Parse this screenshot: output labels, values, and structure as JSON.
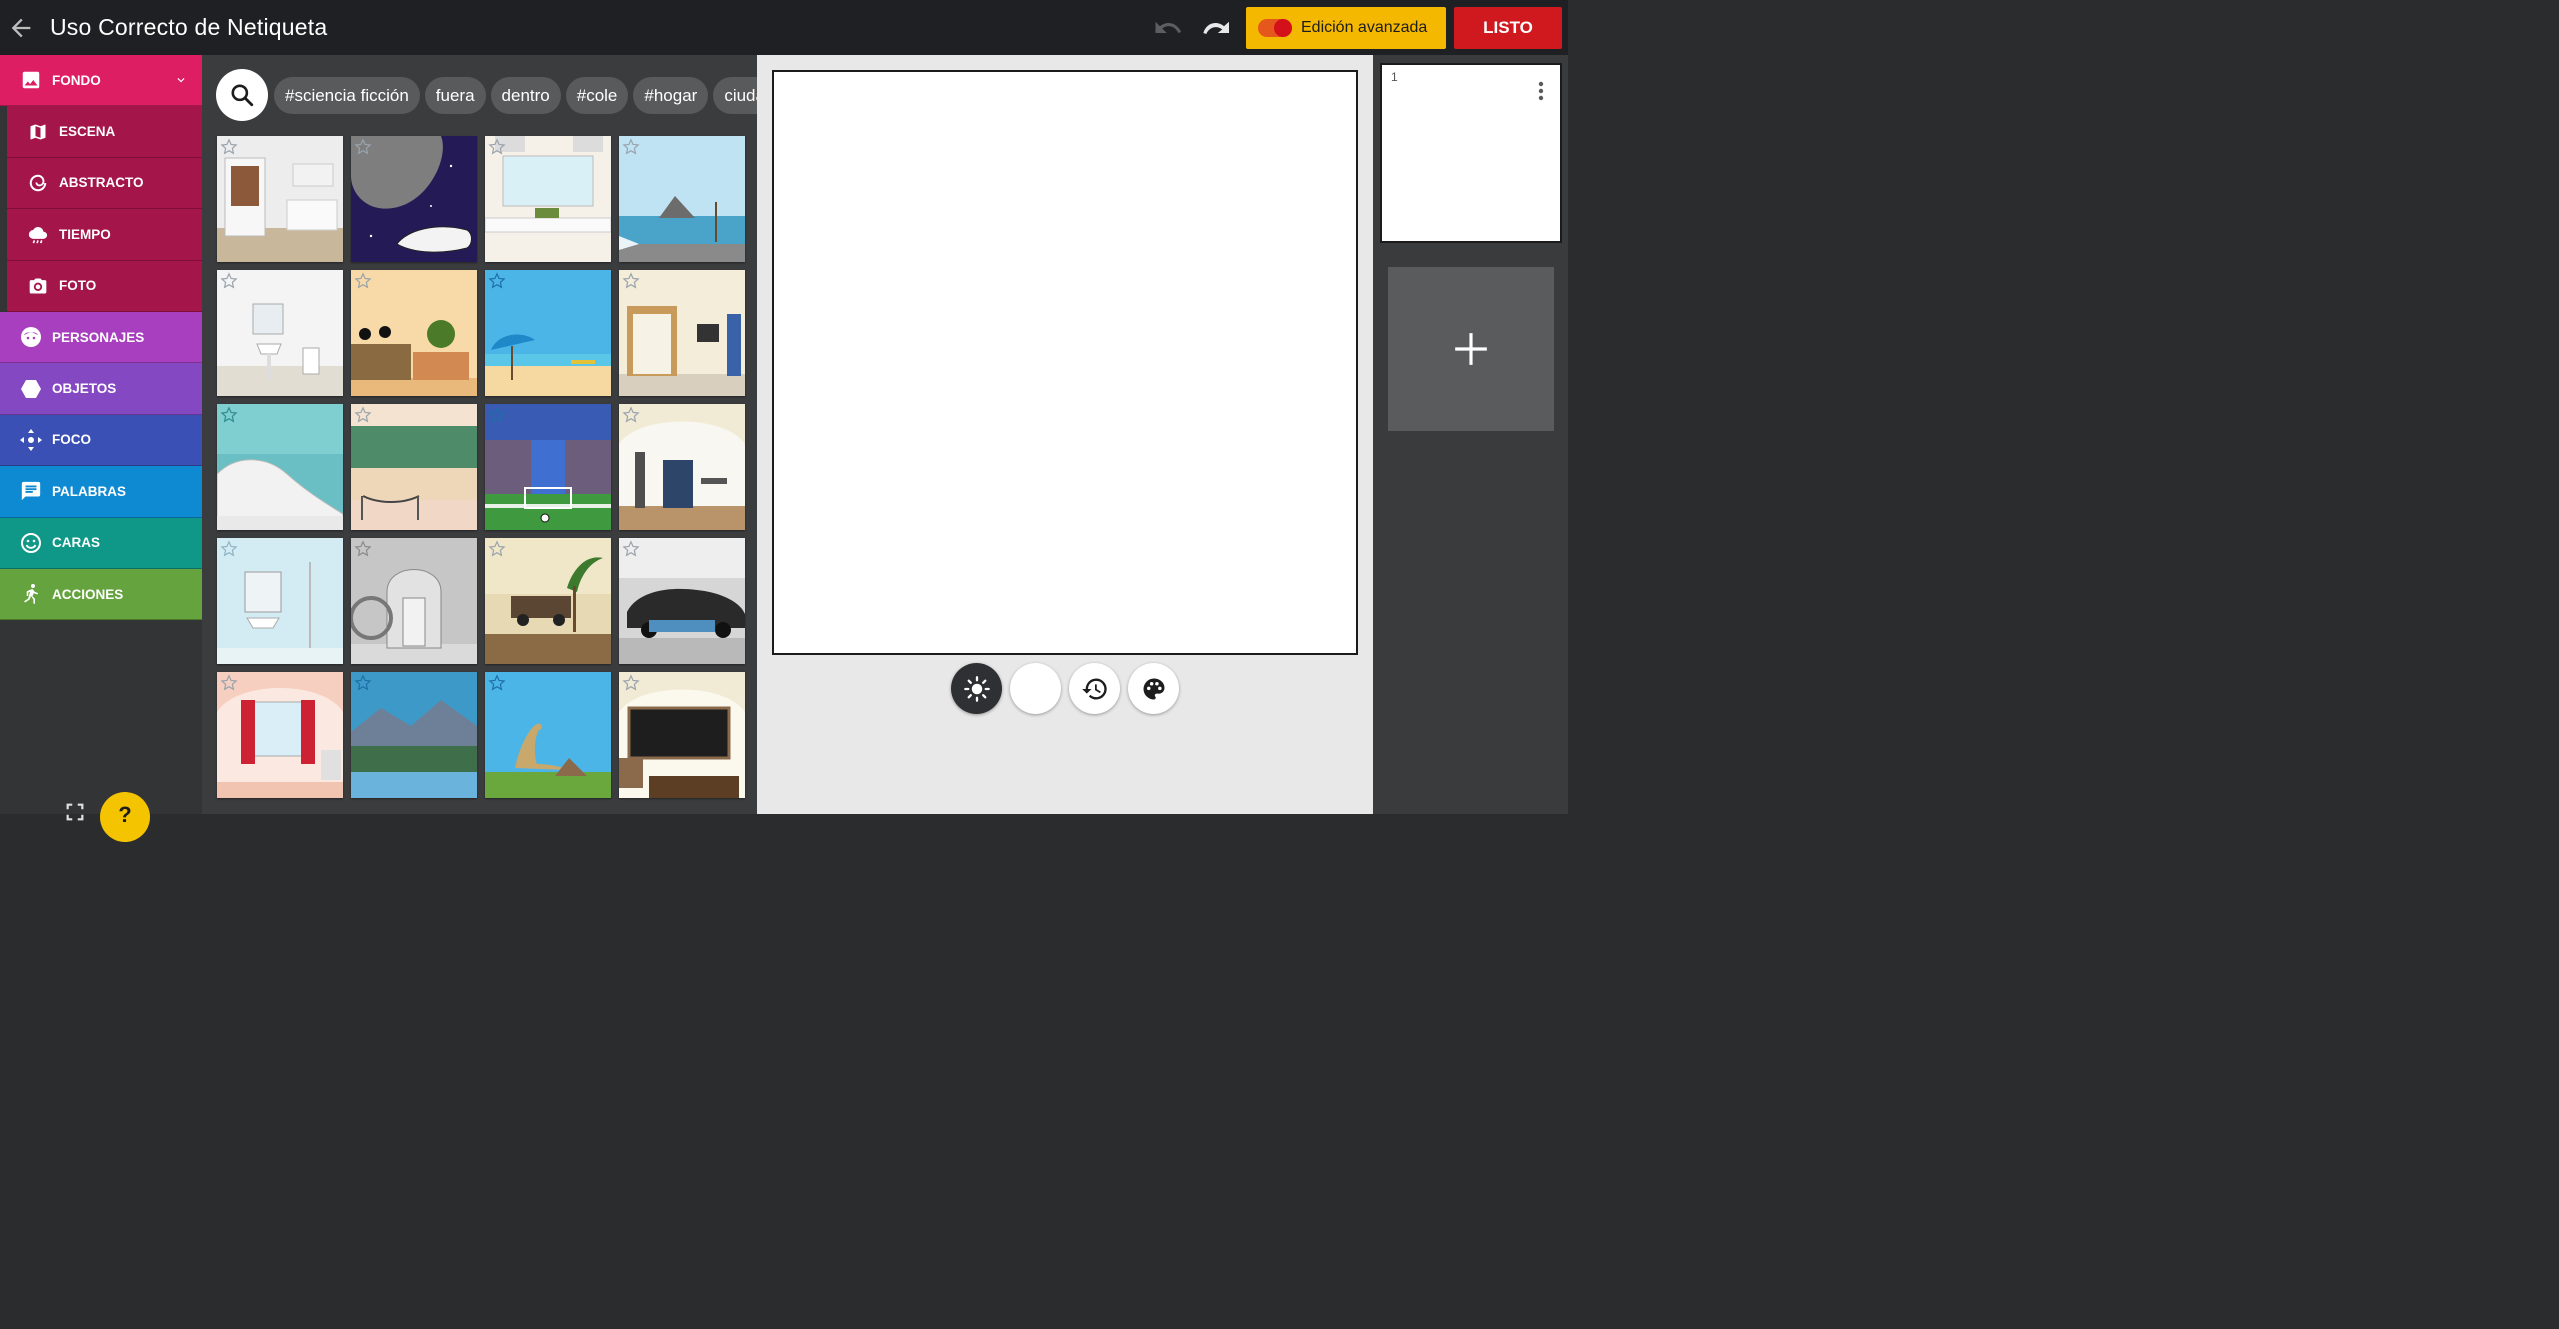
{
  "header": {
    "title": "Uso Correcto de Netiqueta",
    "advanced_label": "Edición avanzada",
    "done_label": "LISTO"
  },
  "sidebar": {
    "main": {
      "label": "FONDO",
      "color": "#dd1e63"
    },
    "subitems": [
      {
        "label": "ESCENA",
        "icon": "map-icon"
      },
      {
        "label": "ABSTRACTO",
        "icon": "spiral-icon"
      },
      {
        "label": "TIEMPO",
        "icon": "weather-icon"
      },
      {
        "label": "FOTO",
        "icon": "camera-icon"
      }
    ],
    "categories": [
      {
        "label": "PERSONAJES",
        "color": "#a73fbe"
      },
      {
        "label": "OBJETOS",
        "color": "#8449c2"
      },
      {
        "label": "FOCO",
        "color": "#3b50b5"
      },
      {
        "label": "PALABRAS",
        "color": "#0e8ad3"
      },
      {
        "label": "CARAS",
        "color": "#0f9787"
      },
      {
        "label": "ACCIONES",
        "color": "#64a33d"
      }
    ],
    "help_label": "?"
  },
  "gallery": {
    "tags": [
      "#sciencia ficción",
      "fuera",
      "dentro",
      "#cole",
      "#hogar",
      "ciudad"
    ]
  },
  "pages": {
    "items": [
      {
        "number": "1"
      }
    ]
  },
  "colors": {
    "topbar": "#1f2023",
    "advanced": "#f5b800",
    "done": "#d0191f"
  }
}
